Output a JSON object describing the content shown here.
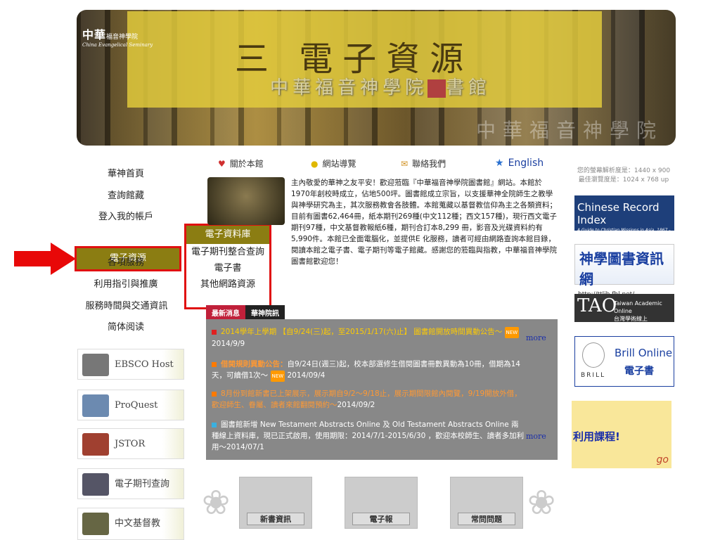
{
  "banner": {
    "logo_cn": "中華",
    "logo_cn_small": "福音神學院",
    "logo_en": "China Evangelical Seminary",
    "title": "三 電子資源",
    "subtitle": "中華福音神學院",
    "subtitle_suffix": "書館",
    "spine": "中華福音神學院"
  },
  "nav": {
    "items": [
      "華神首頁",
      "查詢館藏",
      "登入我的帳戶",
      "電子資源",
      "各項服務",
      "利用指引與推廣",
      "服務時間與交通資訊",
      "简体阅读"
    ]
  },
  "submenu": {
    "header": "電子資料庫",
    "items": [
      "電子期刊整合查詢",
      "電子書",
      "其他網路資源"
    ]
  },
  "databases": [
    "EBSCO Host",
    "ProQuest",
    "JSTOR",
    "電子期刊查詢",
    "中文基督教"
  ],
  "topmenu": {
    "about": "關於本館",
    "guide": "網站導覽",
    "contact": "聯絡我們",
    "english": "English"
  },
  "intro": "主內敬愛的華神之友平安！歡迎蒞臨『中華福音神學院圖書館』網站。本館於1970年創校時成立，佔地500坪。圖書館成立宗旨，以支援華神全院師生之教學與神學研究為主，其次服務教會各肢體。本館蒐藏以基督教信仰為主之各類資料；目前有圖書62,464冊，紙本期刊269種(中文112種；西文157種)，現行西文電子期刊97種，中文基督教報紙6種，期刊合訂本8,299 冊，影音及光碟資料約有5,990件。本館已全面電腦化，並提供E 化服務，讀者可經由網路查詢本館目錄，閱讀本館之電子書、電子期刊等電子館藏。感謝您的蒞臨與指教，中華福音神學院圖書館歡迎您！",
  "news_tabs": [
    "最新消息",
    "華神院訊"
  ],
  "news": [
    {
      "text": "2014學年上學期 【自9/24(三)起，至2015/1/17(六)止】 圖書館開放時間異動公告～",
      "date": "2014/9/9",
      "more": "more"
    },
    {
      "text_hl": "借閱規則異動公告：",
      "text": "自9/24日(週三)起，校本部選修生借閱圖書冊數異動為10冊，借期為14天，可續借1次～",
      "date": "2014/09/4"
    },
    {
      "text": "8月份到館新書已上架展示，展示期自9/2～9/18止，展示期間限館內閱覽，9/19開放外借，歡迎師生、眷屬、讀者來館翻閱預約～",
      "date": "2014/09/2"
    },
    {
      "text": "圖書館新增 New Testament Abstracts Online 及 Old Testament Abstracts Online 兩種線上資料庫，現已正式啟用，使用期限：2014/7/1-2015/6/30 ，歡迎本校師生、讀者多加利用～",
      "date": "2014/07/1",
      "more": "more"
    }
  ],
  "new_badge": "NEW",
  "bottom_buttons": [
    "新書資訊",
    "電子報",
    "常問問題"
  ],
  "right": {
    "resolution_text": "您的螢幕解析度是：1440 x 900",
    "best_text": "最佳瀏覽度是：1024 x 768 up",
    "cri_title": "Chinese Record Index",
    "cri_sub": "A Guide to Christian Missions in Asia, 1867 - 1941",
    "ttlib_title": "神學圖書資訊網",
    "ttlib_url": "http://ttlib.fhl.net/",
    "tao_title": "TAO",
    "tao_sub1": "Taiwan Academic Online",
    "tao_sub2": "台灣學術線上",
    "brill_title": "Brill Online",
    "brill_cn": "電子書",
    "brill_logo": "BRILL",
    "course_title": "利用課程!",
    "course_go": "go"
  }
}
